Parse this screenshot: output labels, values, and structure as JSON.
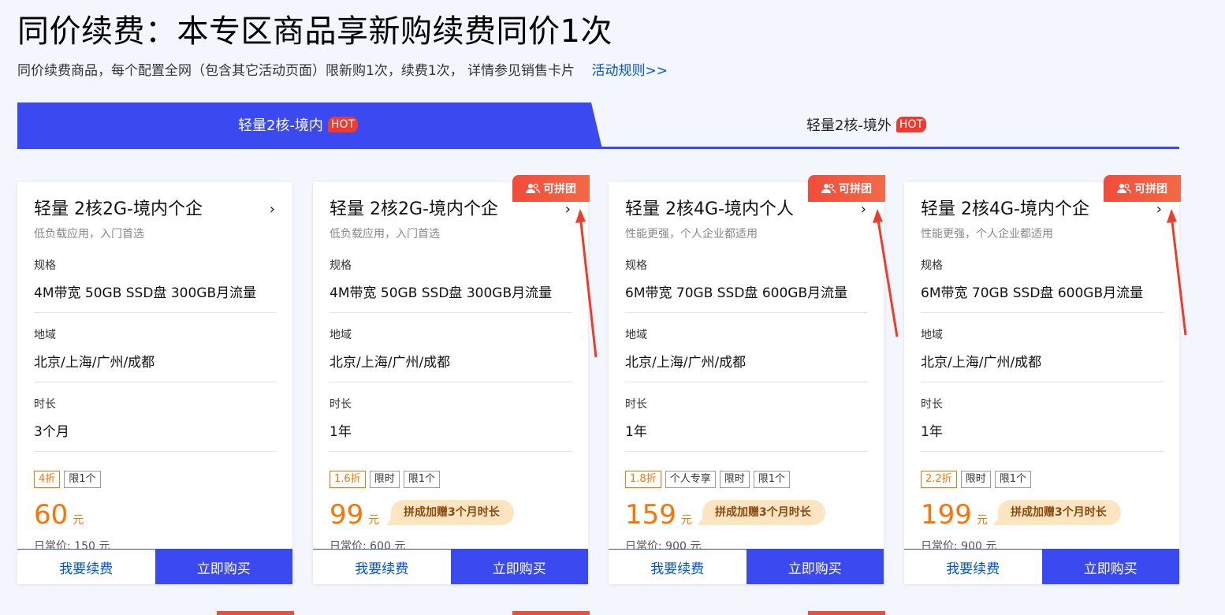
{
  "page": {
    "title": "同价续费：本专区商品享新购续费同价1次",
    "subtitle": "同价续费商品，每个配置全网（包含其它活动页面）限新购1次，续费1次， 详情参见销售卡片",
    "rule_link": "活动规则>>"
  },
  "tabs": [
    {
      "label": "轻量2核-境内",
      "badge": "HOT",
      "active": true
    },
    {
      "label": "轻量2核-境外",
      "badge": "HOT",
      "active": false
    }
  ],
  "labels": {
    "spec": "规格",
    "region": "地域",
    "duration": "时长",
    "yuan": "元",
    "renew": "我要续费",
    "buy": "立即购买",
    "group": "可拼团",
    "gift": "拼成加赠3个月时长"
  },
  "cards": [
    {
      "title": "轻量 2核2G-境内个企",
      "desc": "低负载应用，入门首选",
      "spec": "4M带宽 50GB SSD盘 300GB月流量",
      "region": "北京/上海/广州/成都",
      "duration": "3个月",
      "tags": [
        "4折",
        "限1个"
      ],
      "price": "60",
      "orig": "日常价: 150 元",
      "group": false
    },
    {
      "title": "轻量 2核2G-境内个企",
      "desc": "低负载应用，入门首选",
      "spec": "4M带宽 50GB SSD盘 300GB月流量",
      "region": "北京/上海/广州/成都",
      "duration": "1年",
      "tags": [
        "1.6折",
        "限时",
        "限1个"
      ],
      "price": "99",
      "orig": "日常价: 600 元",
      "group": true
    },
    {
      "title": "轻量 2核4G-境内个人",
      "desc": "性能更强，个人企业都适用",
      "spec": "6M带宽 70GB SSD盘 600GB月流量",
      "region": "北京/上海/广州/成都",
      "duration": "1年",
      "tags": [
        "1.8折",
        "个人专享",
        "限时",
        "限1个"
      ],
      "price": "159",
      "orig": "日常价: 900 元",
      "group": true
    },
    {
      "title": "轻量 2核4G-境内个企",
      "desc": "性能更强，个人企业都适用",
      "spec": "6M带宽 70GB SSD盘 600GB月流量",
      "region": "北京/上海/广州/成都",
      "duration": "1年",
      "tags": [
        "2.2折",
        "限时",
        "限1个"
      ],
      "price": "199",
      "orig": "日常价: 900 元",
      "group": true
    }
  ]
}
